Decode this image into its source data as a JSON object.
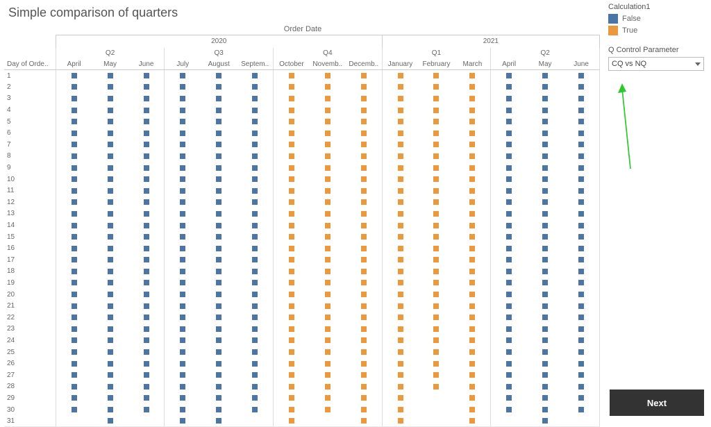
{
  "title": "Simple comparison of quarters",
  "axis_top_label": "Order Date",
  "row_header": "Day of Orde..",
  "years": [
    "2020",
    "2021"
  ],
  "quarters_top": [
    "Q2",
    "Q3",
    "Q4",
    "Q1",
    "Q2"
  ],
  "months": [
    "April",
    "May",
    "June",
    "July",
    "August",
    "Septem..",
    "October",
    "Novemb..",
    "Decemb..",
    "January",
    "February",
    "March",
    "April",
    "May",
    "June"
  ],
  "days": [
    "1",
    "2",
    "3",
    "4",
    "5",
    "6",
    "7",
    "8",
    "9",
    "10",
    "11",
    "12",
    "13",
    "14",
    "15",
    "16",
    "17",
    "18",
    "19",
    "20",
    "21",
    "22",
    "23",
    "24",
    "25",
    "26",
    "27",
    "28",
    "29",
    "30",
    "31"
  ],
  "legend": {
    "title": "Calculation1",
    "items": [
      {
        "label": "False",
        "cls": "false"
      },
      {
        "label": "True",
        "cls": "true"
      }
    ]
  },
  "parameter": {
    "title": "Q Control Parameter",
    "value": "CQ vs NQ"
  },
  "next_label": "Next",
  "colors": {
    "false": "#4a75a5",
    "true": "#ea9a3c"
  },
  "chart_data": {
    "type": "heatmap",
    "title": "Simple comparison of quarters",
    "xlabel": "Order Date",
    "ylabel": "Day of Order Date",
    "x": [
      "April 2020",
      "May 2020",
      "June 2020",
      "July 2020",
      "August 2020",
      "September 2020",
      "October 2020",
      "November 2020",
      "December 2020",
      "January 2021",
      "February 2021",
      "March 2021",
      "April 2021",
      "May 2021",
      "June 2021"
    ],
    "quarters": [
      "Q2 2020",
      "Q2 2020",
      "Q2 2020",
      "Q3 2020",
      "Q3 2020",
      "Q3 2020",
      "Q4 2020",
      "Q4 2020",
      "Q4 2020",
      "Q1 2021",
      "Q1 2021",
      "Q1 2021",
      "Q2 2021",
      "Q2 2021",
      "Q2 2021"
    ],
    "y": [
      1,
      2,
      3,
      4,
      5,
      6,
      7,
      8,
      9,
      10,
      11,
      12,
      13,
      14,
      15,
      16,
      17,
      18,
      19,
      20,
      21,
      22,
      23,
      24,
      25,
      26,
      27,
      28,
      29,
      30,
      31
    ],
    "month_lengths": [
      30,
      31,
      30,
      31,
      31,
      30,
      31,
      30,
      31,
      31,
      28,
      31,
      30,
      31,
      30
    ],
    "color_field": "Calculation1",
    "color_values_per_month": [
      "False",
      "False",
      "False",
      "False",
      "False",
      "False",
      "True",
      "True",
      "True",
      "True",
      "True",
      "True",
      "False",
      "False",
      "False"
    ],
    "legend": {
      "False": "#4a75a5",
      "True": "#ea9a3c"
    },
    "note": "Each cell is a square mark; cell present when day <= month length."
  }
}
